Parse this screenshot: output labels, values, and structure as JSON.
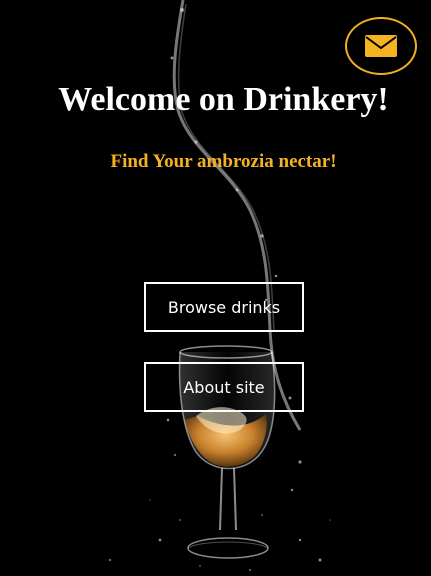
{
  "hero": {
    "title": "Welcome on Drinkery!",
    "subtitle": "Find Your ambrozia nectar!"
  },
  "actions": {
    "browse_label": "Browse drinks",
    "about_label": "About site"
  },
  "contact": {
    "icon": "envelope-icon"
  },
  "colors": {
    "background": "#000000",
    "accent": "#f5b324",
    "text": "#ffffff"
  }
}
